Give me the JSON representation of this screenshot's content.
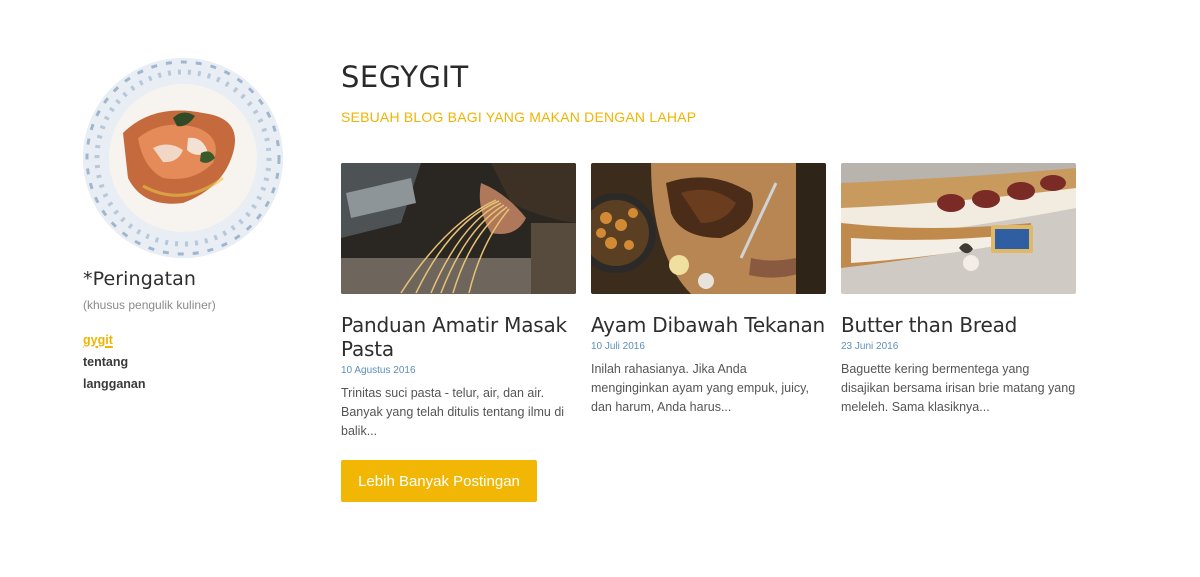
{
  "sidebar": {
    "title": "*Peringatan",
    "subtitle": "(khusus pengulik kuliner)",
    "nav": [
      {
        "label": "gygit"
      },
      {
        "label": "tentang"
      },
      {
        "label": "langganan"
      }
    ]
  },
  "header": {
    "title": "SEGYGIT",
    "tagline": "SEBUAH BLOG BAGI YANG MAKAN DENGAN LAHAP"
  },
  "posts": [
    {
      "title": "Panduan Amatir Masak Pasta",
      "date": "10 Agustus 2016",
      "excerpt": "Trinitas suci pasta - telur, air, dan air. Banyak yang telah ditulis tentang ilmu di balik..."
    },
    {
      "title": "Ayam Dibawah Tekanan",
      "date": "10 Juli 2016",
      "excerpt": "Inilah rahasianya. Jika Anda menginginkan ayam yang empuk, juicy, dan harum, Anda harus..."
    },
    {
      "title": "Butter than Bread",
      "date": "23 Juni 2016",
      "excerpt": "Baguette kering bermentega yang disajikan bersama irisan brie matang yang meleleh. Sama klasiknya..."
    }
  ],
  "more_button": {
    "label": "Lebih Banyak Postingan"
  },
  "colors": {
    "accent": "#f2b705",
    "date": "#5c8fb8"
  }
}
